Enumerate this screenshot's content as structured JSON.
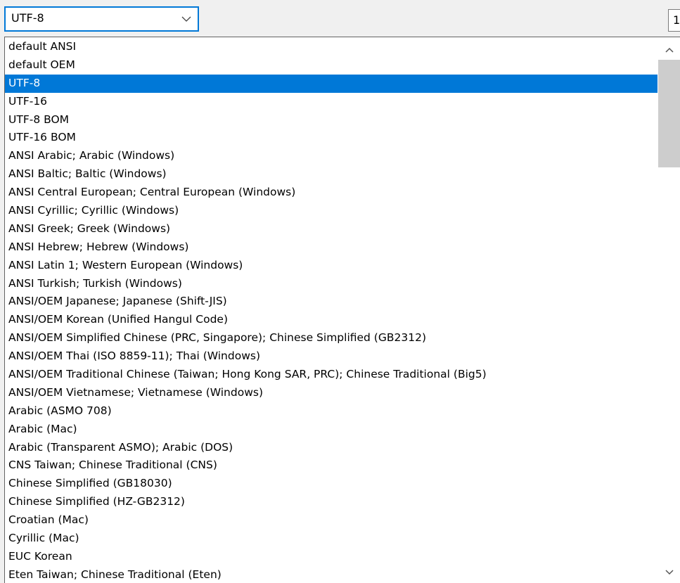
{
  "combo": {
    "value": "UTF-8",
    "arrow_icon": "chevron-down-icon"
  },
  "side_field": {
    "value": "1"
  },
  "dropdown": {
    "selected": "UTF-8",
    "items": [
      "default ANSI",
      "default OEM",
      "UTF-8",
      "UTF-16",
      "UTF-8 BOM",
      "UTF-16 BOM",
      "ANSI Arabic; Arabic (Windows)",
      "ANSI Baltic; Baltic (Windows)",
      "ANSI Central European; Central European (Windows)",
      "ANSI Cyrillic; Cyrillic (Windows)",
      "ANSI Greek; Greek (Windows)",
      "ANSI Hebrew; Hebrew (Windows)",
      "ANSI Latin 1; Western European (Windows)",
      "ANSI Turkish; Turkish (Windows)",
      "ANSI/OEM Japanese; Japanese (Shift-JIS)",
      "ANSI/OEM Korean (Unified Hangul Code)",
      "ANSI/OEM Simplified Chinese (PRC, Singapore); Chinese Simplified (GB2312)",
      "ANSI/OEM Thai (ISO 8859-11); Thai (Windows)",
      "ANSI/OEM Traditional Chinese (Taiwan; Hong Kong SAR, PRC); Chinese Traditional (Big5)",
      "ANSI/OEM Vietnamese; Vietnamese (Windows)",
      "Arabic (ASMO 708)",
      "Arabic (Mac)",
      "Arabic (Transparent ASMO); Arabic (DOS)",
      "CNS Taiwan; Chinese Traditional (CNS)",
      "Chinese Simplified (GB18030)",
      "Chinese Simplified (HZ-GB2312)",
      "Croatian (Mac)",
      "Cyrillic (Mac)",
      "EUC Korean",
      "Eten Taiwan; Chinese Traditional (Eten)"
    ]
  },
  "scrollbar": {
    "up_icon": "chevron-up-icon",
    "down_icon": "chevron-down-icon",
    "position_fraction": 0.0
  },
  "colors": {
    "selection": "#0078d7",
    "focus_border": "#0078d7",
    "scroll_thumb": "#cdcdcd"
  }
}
